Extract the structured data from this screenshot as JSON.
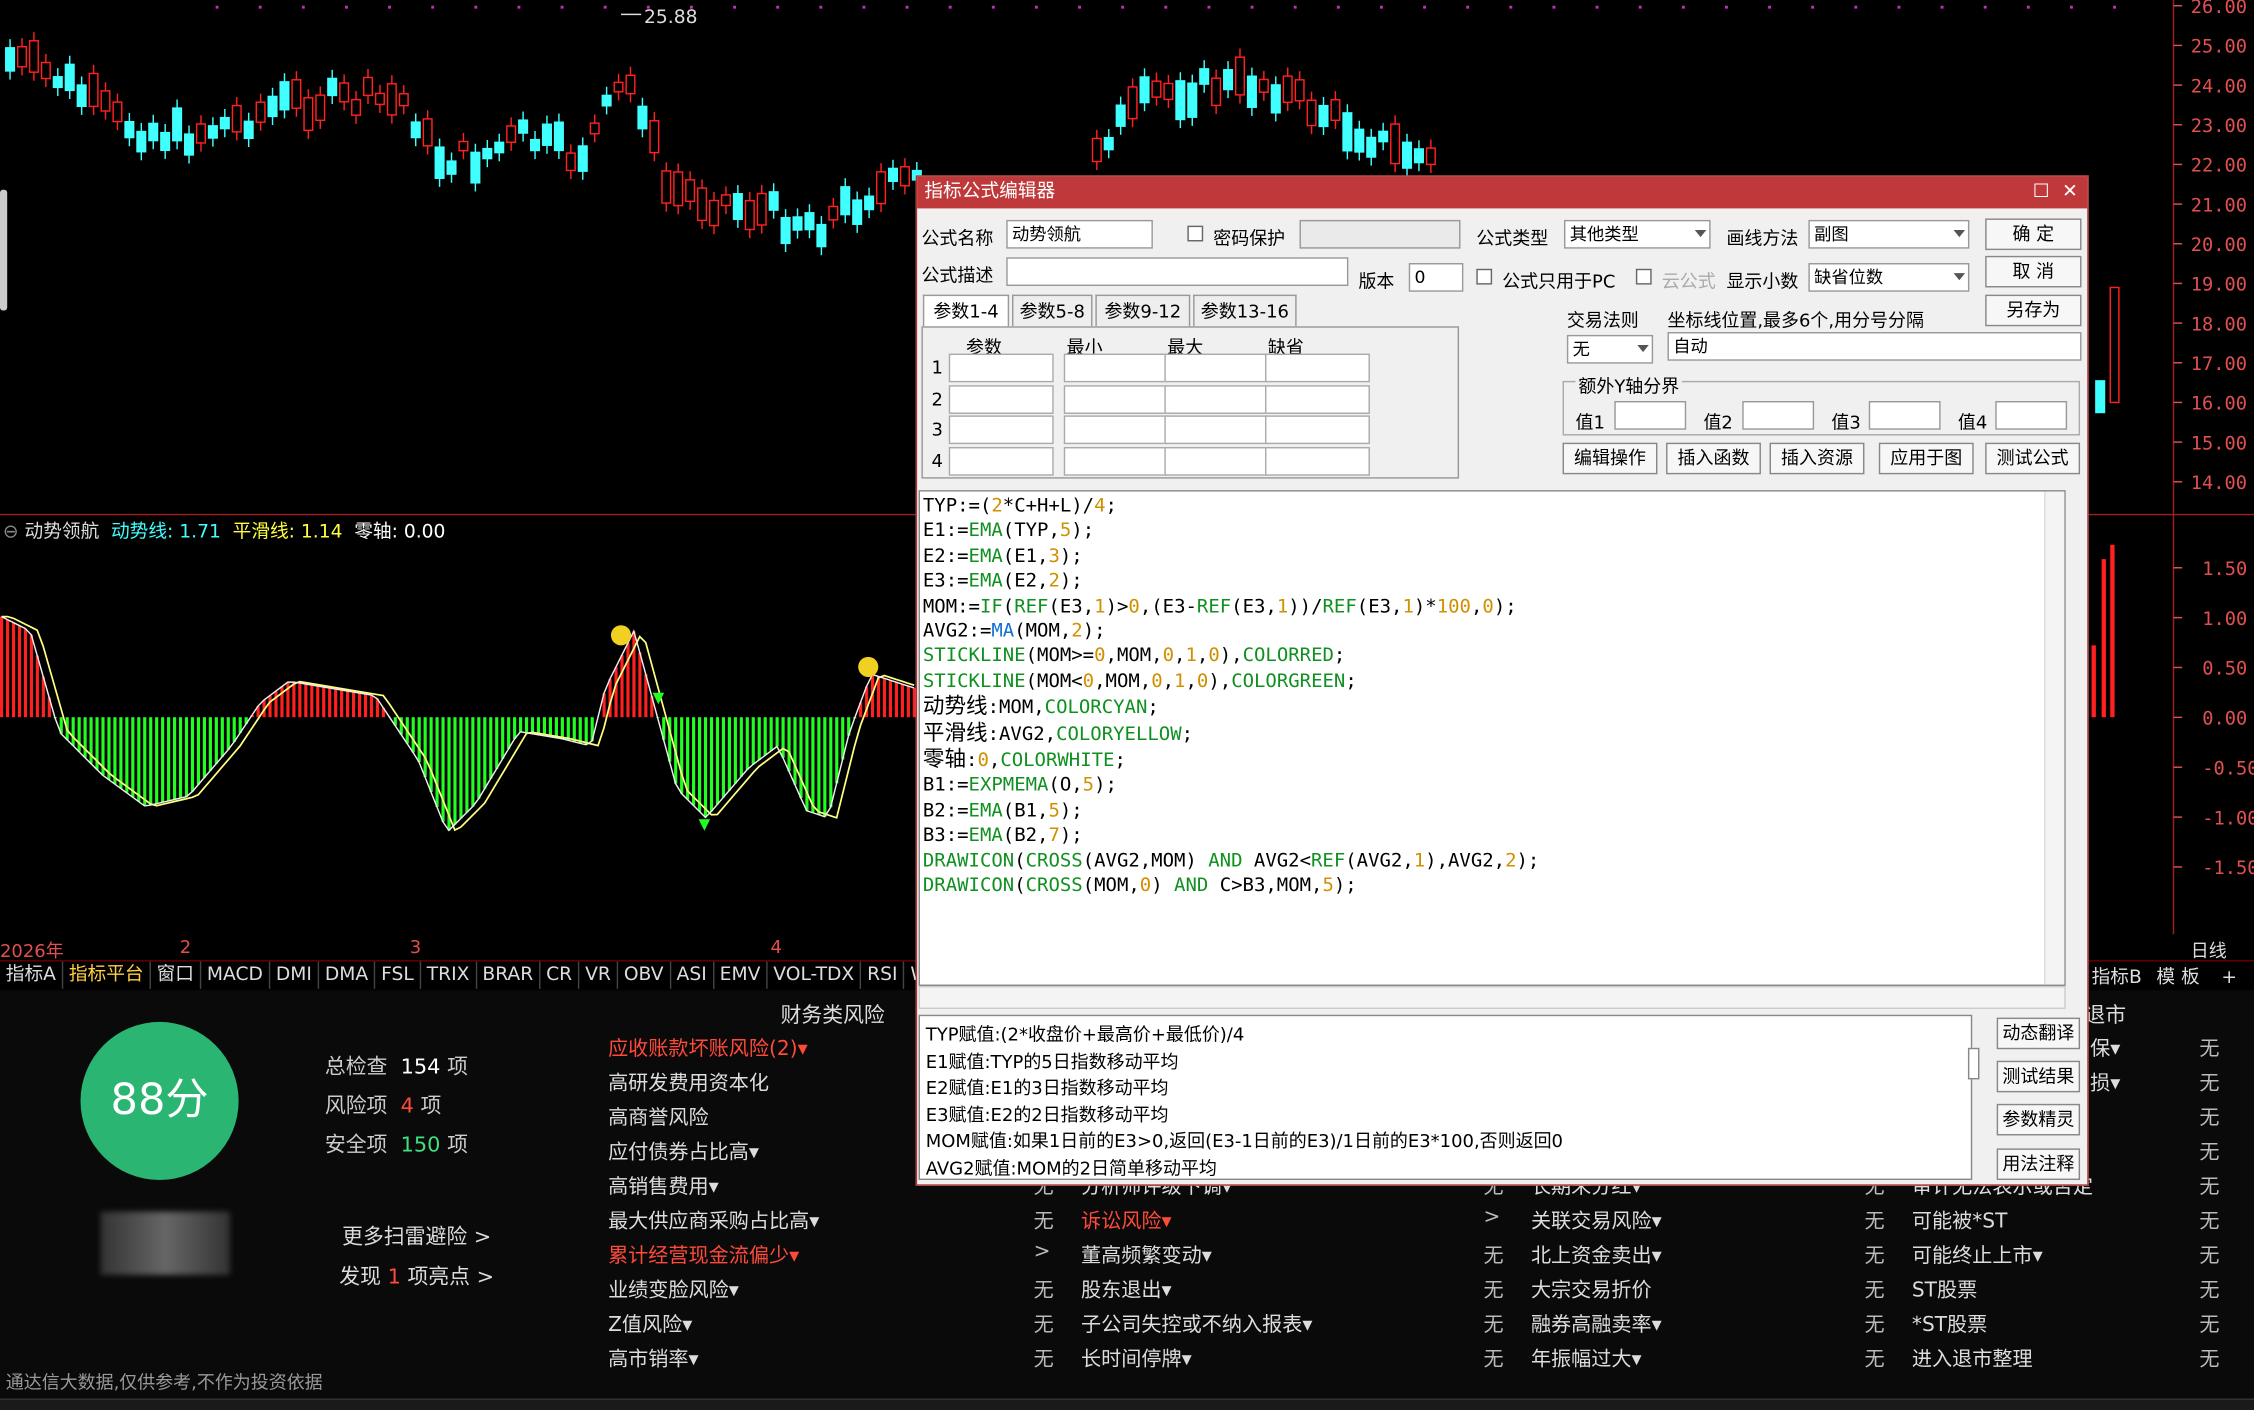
{
  "chart": {
    "price_axis": [
      "26.00",
      "25.00",
      "24.00",
      "23.00",
      "22.00",
      "21.00",
      "20.00",
      "19.00",
      "18.00",
      "17.00",
      "16.00",
      "15.00",
      "14.00"
    ],
    "high_marker": "25.88",
    "indicator_axis": [
      "1.50",
      "1.00",
      "0.50",
      "0.00",
      "-0.50",
      "-1.00",
      "-1.50"
    ],
    "indicator_header": {
      "name": "动势领航",
      "line1": "动势线: 1.71",
      "line2": "平滑线: 1.14",
      "line3": "零轴: 0.00"
    },
    "dates": [
      "2026年",
      "2",
      "3",
      "4"
    ],
    "period": "日线",
    "colors": {
      "up": "#ff2020",
      "down": "#40ffff",
      "bar_pos": "#ff2020",
      "bar_neg": "#20ff20",
      "line": "#ffff40"
    }
  },
  "indicator_tabs": [
    "指标A",
    "指标平台",
    "窗口",
    "MACD",
    "DMI",
    "DMA",
    "FSL",
    "TRIX",
    "BRAR",
    "CR",
    "VR",
    "OBV",
    "ASI",
    "EMV",
    "VOL-TDX",
    "RSI",
    "WR"
  ],
  "right_tabs": [
    "指标B",
    "模 板",
    "+",
    "-"
  ],
  "score": {
    "value": "88分",
    "total_label": "总检查",
    "total": "154",
    "unit": "项",
    "risk_label": "风险项",
    "risk": "4",
    "safe_label": "安全项",
    "safe": "150",
    "more": "更多扫雷避险 >",
    "found_pre": "发现",
    "found_num": "1",
    "found_post": "项亮点 >",
    "footer": "通达信大数据,仅供参考,不作为投资依据"
  },
  "risk": {
    "col1_title": "财务类风险",
    "col1": [
      {
        "label": "应收账款坏账风险(2)▾",
        "hl": true,
        "status": ""
      },
      {
        "label": "高研发费用资本化",
        "hl": false,
        "status": ""
      },
      {
        "label": "高商誉风险",
        "hl": false,
        "status": ""
      },
      {
        "label": "应付债券占比高▾",
        "hl": false,
        "status": ""
      },
      {
        "label": "高销售费用▾",
        "hl": false,
        "status": "无"
      },
      {
        "label": "最大供应商采购占比高▾",
        "hl": false,
        "status": "无"
      },
      {
        "label": "累计经营现金流偏少▾",
        "hl": true,
        "status": ">"
      },
      {
        "label": "业绩变脸风险▾",
        "hl": false,
        "status": "无"
      },
      {
        "label": "Z值风险▾",
        "hl": false,
        "status": "无"
      },
      {
        "label": "高市销率▾",
        "hl": false,
        "status": "无"
      }
    ],
    "col2": [
      {
        "label": "分析师评级下调▾",
        "hl": false,
        "status": "无"
      },
      {
        "label": "诉讼风险▾",
        "hl": true,
        "status": ">"
      },
      {
        "label": "董高频繁变动▾",
        "hl": false,
        "status": "无"
      },
      {
        "label": "股东退出▾",
        "hl": false,
        "status": "无"
      },
      {
        "label": "子公司失控或不纳入报表▾",
        "hl": false,
        "status": "无"
      },
      {
        "label": "长时间停牌▾",
        "hl": false,
        "status": "无"
      }
    ],
    "col3": [
      {
        "label": "长期未分红▾",
        "status": "无"
      },
      {
        "label": "关联交易风险▾",
        "status": "无"
      },
      {
        "label": "北上资金卖出▾",
        "status": "无"
      },
      {
        "label": "大宗交易折价",
        "status": "无"
      },
      {
        "label": "融券高融卖率▾",
        "status": "无"
      },
      {
        "label": "年振幅过大▾",
        "status": "无"
      }
    ],
    "col4_title": "退市",
    "col4_top": [
      {
        "label": "保▾",
        "status": "无"
      },
      {
        "label": "损▾",
        "status": "无"
      },
      {
        "label": "",
        "status": "无"
      },
      {
        "label": "",
        "status": "无"
      }
    ],
    "col4": [
      {
        "label": "审计无法表示或否定",
        "status": "无"
      },
      {
        "label": "可能被*ST",
        "status": "无"
      },
      {
        "label": "可能终止上市▾",
        "status": "无"
      },
      {
        "label": "ST股票",
        "status": "无"
      },
      {
        "label": "*ST股票",
        "status": "无"
      },
      {
        "label": "进入退市整理",
        "status": "无"
      }
    ]
  },
  "dialog": {
    "title": "指标公式编辑器",
    "name_label": "公式名称",
    "name_value": "动势领航",
    "pwd_label": "密码保护",
    "type_label": "公式类型",
    "type_value": "其他类型",
    "draw_label": "画线方法",
    "draw_value": "副图",
    "ok": "确  定",
    "cancel": "取  消",
    "saveas": "另存为",
    "desc_label": "公式描述",
    "ver_label": "版本",
    "ver_value": "0",
    "pc_label": "公式只用于PC",
    "cloud_label": "云公式",
    "decimal_label": "显示小数",
    "decimal_value": "缺省位数",
    "ptabs": [
      "参数1-4",
      "参数5-8",
      "参数9-12",
      "参数13-16"
    ],
    "pheaders": [
      "参数",
      "最小",
      "最大",
      "缺省"
    ],
    "prows": [
      "1",
      "2",
      "3",
      "4"
    ],
    "trade_label": "交易法则",
    "trade_value": "无",
    "coord_label": "坐标线位置,最多6个,用分号分隔",
    "coord_value": "自动",
    "yaxis_label": "额外Y轴分界",
    "yvals": [
      "值1",
      "值2",
      "值3",
      "值4"
    ],
    "btns": [
      "编辑操作",
      "插入函数",
      "插入资源",
      "应用于图",
      "测试公式"
    ],
    "side_btns": [
      "动态翻译",
      "测试结果",
      "参数精灵",
      "用法注释"
    ],
    "desc_lines": [
      "TYP赋值:(2*收盘价+最高价+最低价)/4",
      "E1赋值:TYP的5日指数移动平均",
      "E2赋值:E1的3日指数移动平均",
      "E3赋值:E2的2日指数移动平均",
      "MOM赋值:如果1日前的E3>0,返回(E3-1日前的E3)/1日前的E3*100,否则返回0",
      "AVG2赋值:MOM的2日简单移动平均"
    ]
  }
}
